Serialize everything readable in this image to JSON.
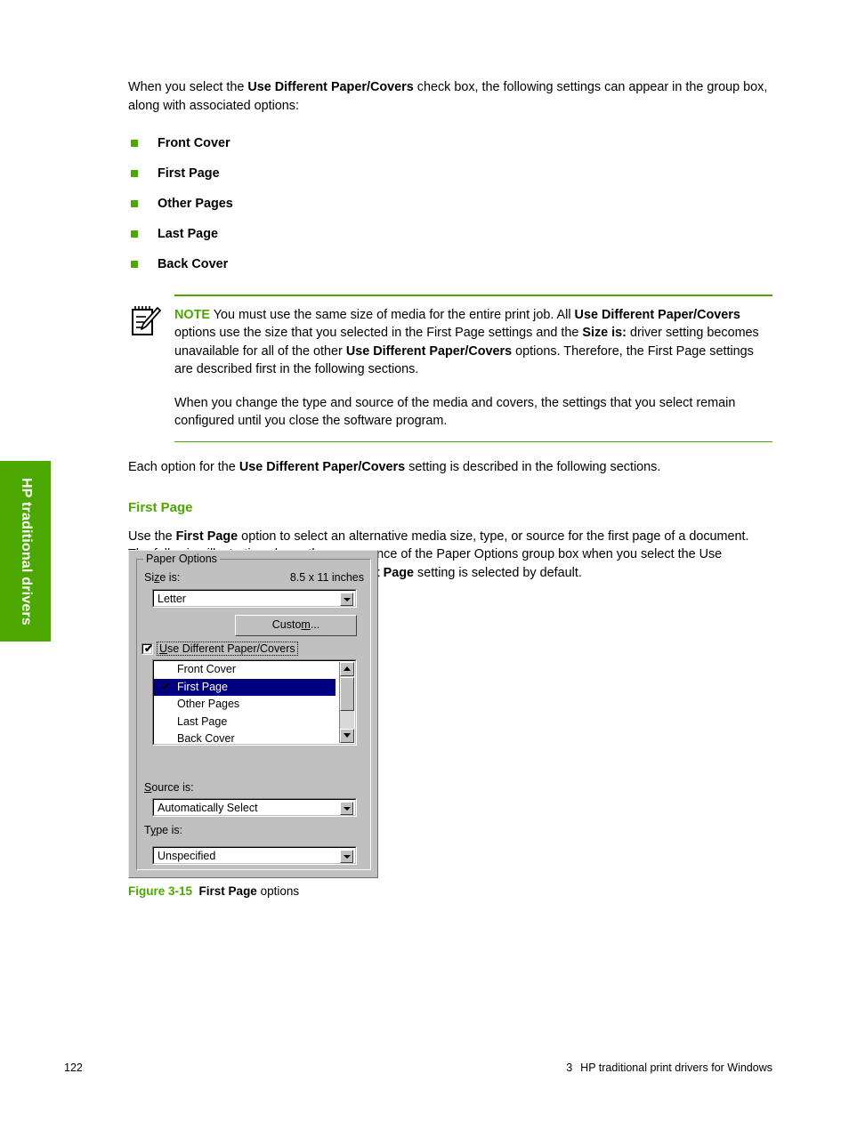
{
  "side_tab": {
    "label": "HP traditional drivers"
  },
  "accent_color": "#4ca700",
  "intro": {
    "part1": "When you select the ",
    "bold1": "Use Different Paper/Covers",
    "part2": " check box, the following settings can appear in the group box, along with associated options:"
  },
  "bullets": [
    {
      "label": "Front Cover"
    },
    {
      "label": "First Page"
    },
    {
      "label": "Other Pages"
    },
    {
      "label": "Last Page"
    },
    {
      "label": "Back Cover"
    }
  ],
  "note": {
    "icon_name": "note-pencil-icon",
    "label": "NOTE",
    "p1_a": " You must use the same size of media for the entire print job. All ",
    "p1_b1": "Use Different Paper/Covers",
    "p1_b": " options use the size that you selected in the First Page settings and the ",
    "p1_b2": "Size is:",
    "p1_c": " driver setting becomes unavailable for all of the other ",
    "p1_b3": "Use Different Paper/Covers",
    "p1_d": " options. Therefore, the First Page settings are described first in the following sections.",
    "p2": "When you change the type and source of the media and covers, the settings that you select remain configured until you close the software program."
  },
  "each_option": {
    "part1": "Each option for the ",
    "bold1": "Use Different Paper/Covers",
    "part2": " setting is described in the following sections."
  },
  "section": {
    "heading": "First Page",
    "para_a": "Use the ",
    "para_b1": "First Page",
    "para_c": " option to select an alternative media size, type, or source for the first page of a document. The following illustration shows the appearance of the Paper Options group box when you select the Use Different Paper/Covers check box. The ",
    "para_b2": "First Page",
    "para_d": " setting is selected by default."
  },
  "dialog": {
    "group_title": "Paper Options",
    "size_label": "Size is:",
    "size_label_accel": "z",
    "size_value_right": "8.5 x 11 inches",
    "size_combo_value": "Letter",
    "custom_button": "Custom...",
    "custom_button_accel": "m",
    "checkbox": {
      "label": "Use Different Paper/Covers",
      "accel": "U",
      "checked": true,
      "check_glyph": "✔"
    },
    "listbox": {
      "items": [
        {
          "label": "Front Cover",
          "selected": false,
          "checked": false
        },
        {
          "label": "First Page",
          "selected": true,
          "checked": true
        },
        {
          "label": "Other Pages",
          "selected": false,
          "checked": false
        },
        {
          "label": "Last Page",
          "selected": false,
          "checked": false
        },
        {
          "label": "Back Cover",
          "selected": false,
          "checked": false
        }
      ],
      "check_glyph": "✔",
      "selection_color": "#000080"
    },
    "source_label": "Source is:",
    "source_label_accel": "S",
    "source_value": "Automatically Select",
    "type_label": "Type is:",
    "type_label_accel": "i",
    "type_value": "Unspecified"
  },
  "figure": {
    "number": "Figure 3-15",
    "bold": "First Page",
    "rest": " options"
  },
  "footer": {
    "page_number": "122",
    "chapter_number": "3",
    "chapter_title": "HP traditional print drivers for Windows"
  }
}
